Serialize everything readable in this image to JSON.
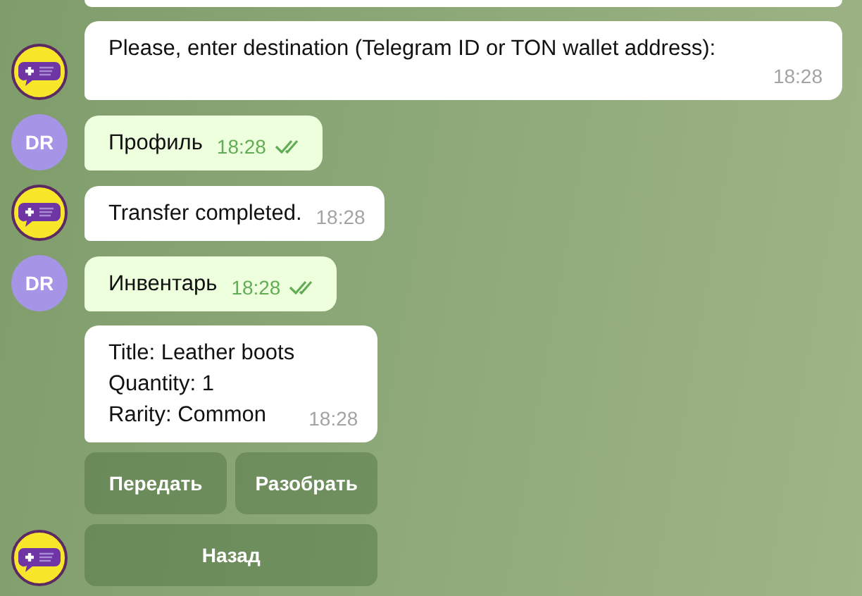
{
  "messages": [
    {
      "kind": "incoming",
      "avatar": {
        "kind": "bot"
      },
      "lines": [
        "Please, enter destination (Telegram ID or TON wallet address):"
      ],
      "time": "18:28",
      "wide": true
    },
    {
      "kind": "outgoing",
      "avatar": {
        "kind": "user",
        "initials": "DR"
      },
      "lines": [
        "Профиль"
      ],
      "time": "18:28",
      "read": true
    },
    {
      "kind": "incoming",
      "avatar": {
        "kind": "bot"
      },
      "lines": [
        "Transfer completed."
      ],
      "time": "18:28"
    },
    {
      "kind": "outgoing",
      "avatar": {
        "kind": "user",
        "initials": "DR"
      },
      "lines": [
        "Инвентарь"
      ],
      "time": "18:28",
      "read": true
    },
    {
      "kind": "incoming",
      "avatar": {
        "kind": "bot"
      },
      "lines": [
        "Title: Leather boots",
        "Quantity: 1",
        "Rarity: Common"
      ],
      "time": "18:28",
      "keyboard": [
        [
          "Передать",
          "Разобрать"
        ],
        [
          "Назад"
        ]
      ]
    }
  ]
}
